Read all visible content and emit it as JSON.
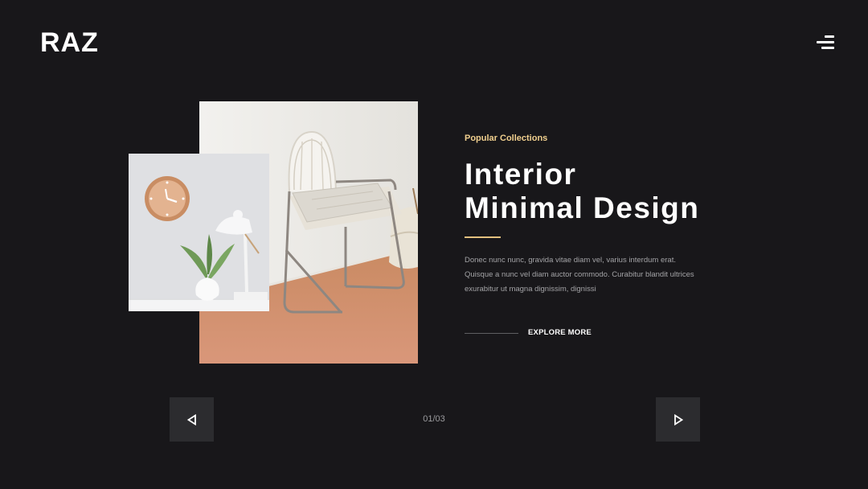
{
  "brand": {
    "logo_text": "RAZ"
  },
  "header": {
    "menu_icon": "hamburger-menu-icon"
  },
  "hero": {
    "eyebrow": "Popular Collections",
    "title_line1": "Interior",
    "title_line2": "Minimal Design",
    "body": "Donec nunc nunc, gravida vitae diam vel, varius interdum erat. Quisque a nunc vel diam auctor commodo. Curabitur blandit ultrices exurabitur ut magna dignissim, dignissi",
    "cta_label": "EXPLORE MORE"
  },
  "slider": {
    "counter": "01/03",
    "prev_icon": "triangle-left-icon",
    "next_icon": "triangle-right-icon"
  },
  "colors": {
    "background": "#18171a",
    "accent": "#f0cf8e",
    "nav_button": "#2c2c2f",
    "text_primary": "#ffffff",
    "text_muted": "#a3a3a6"
  }
}
